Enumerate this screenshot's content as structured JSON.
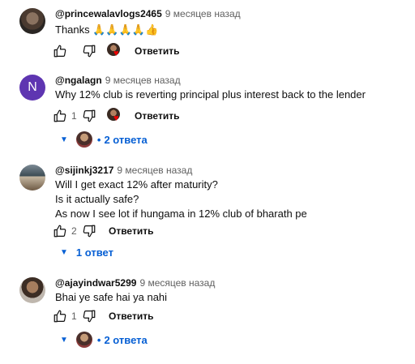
{
  "comments": [
    {
      "author": "@princewalavlogs2465",
      "time": "9 месяцев назад",
      "text_lines": [
        "Thanks 🙏🙏🙏🙏👍"
      ],
      "likes": "",
      "reply_label": "Ответить",
      "creator_hearted": true,
      "replies_label": ""
    },
    {
      "author": "@ngalagn",
      "avatar_letter": "N",
      "time": "9 месяцев назад",
      "text_lines": [
        "Why 12% club is  reverting principal plus interest back to the lender"
      ],
      "likes": "1",
      "reply_label": "Ответить",
      "creator_hearted": true,
      "replies_label": "2 ответа"
    },
    {
      "author": "@sijinkj3217",
      "time": "9 месяцев назад",
      "text_lines": [
        "Will I get exact 12% after maturity?",
        "Is it actually safe?",
        "As now I see lot if hungama in 12% club of bharath pe"
      ],
      "likes": "2",
      "reply_label": "Ответить",
      "creator_hearted": false,
      "replies_label": "1 ответ"
    },
    {
      "author": "@ajayindwar5299",
      "time": "9 месяцев назад",
      "text_lines": [
        "Bhai ye safe hai ya nahi"
      ],
      "likes": "1",
      "reply_label": "Ответить",
      "creator_hearted": false,
      "replies_label": "2 ответа"
    }
  ]
}
